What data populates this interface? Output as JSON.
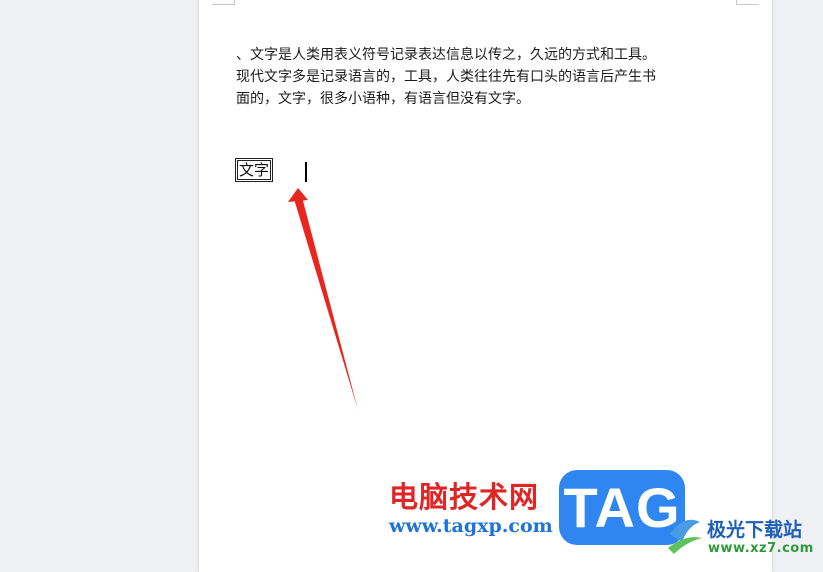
{
  "document": {
    "paragraph_lines": [
      "、文字是人类用表义符号记录表达信息以传之，久远的方式和工具。",
      "现代文字多是记录语言的，工具，人类往往先有口头的语言后产生书",
      "面的，文字，很多小语种，有语言但没有文字。"
    ],
    "enclosed_text": "文字"
  },
  "annotation": {
    "arrow_color": "#e8261d"
  },
  "watermark": {
    "brand_text": "电脑技术网",
    "brand_color": "#e02525",
    "url_text": "www.tagxp.com",
    "url_color": "#1e72d8",
    "tag_text": "TAG",
    "tag_color": "#2f86f0",
    "site_name": "极光下载站",
    "site_url": "www.xz7.com"
  },
  "colors": {
    "canvas_bg": "#eef0f3",
    "page_bg": "#ffffff"
  }
}
